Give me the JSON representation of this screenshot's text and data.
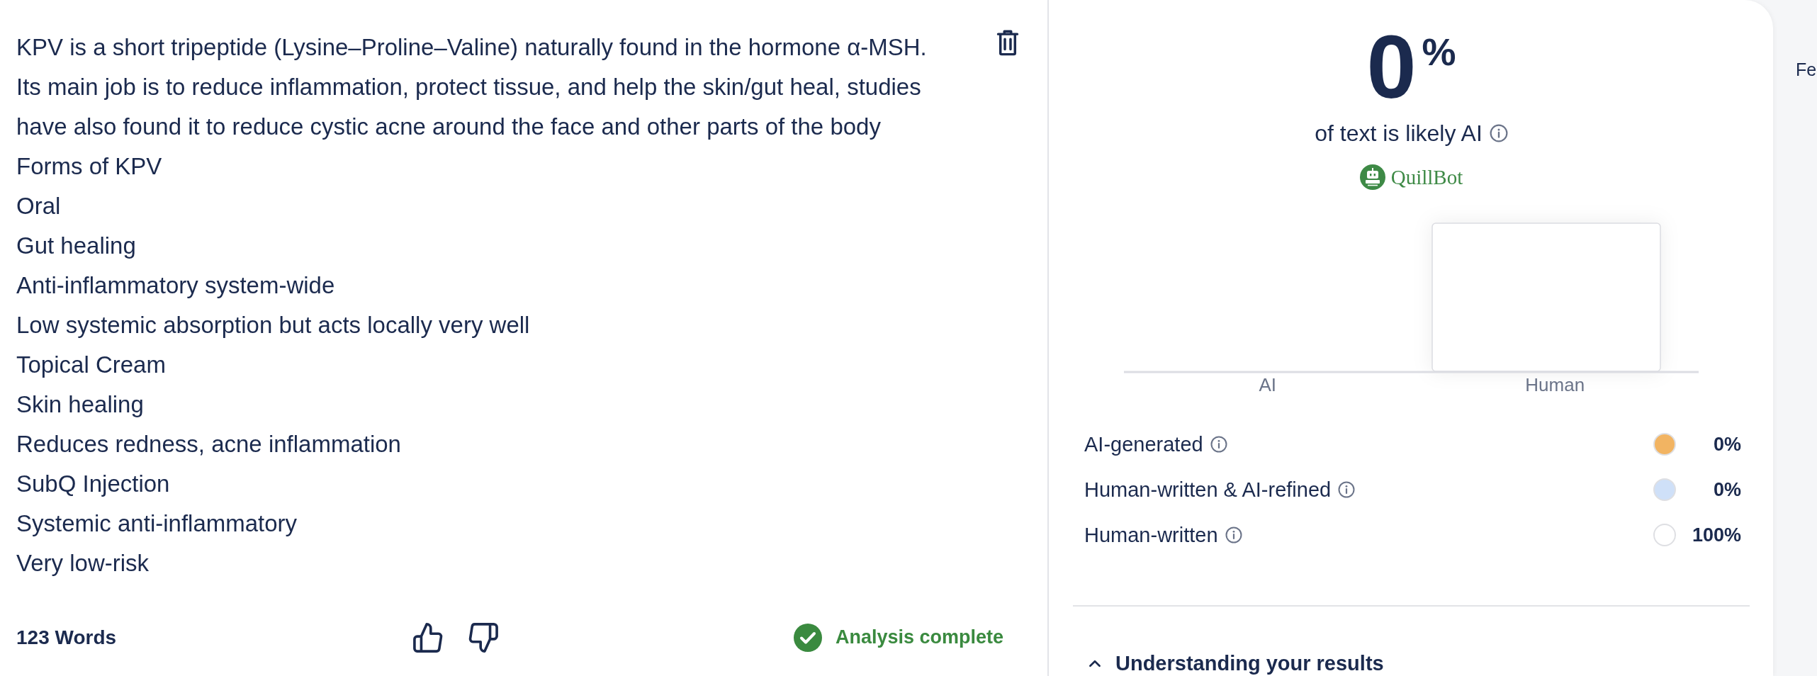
{
  "editor": {
    "paragraphs": [
      "KPV is a short tripeptide (Lysine–Proline–Valine) naturally found in the hormone α-MSH.",
      "Its main job is to reduce inflammation, protect tissue, and help the skin/gut heal, studies have also found it to reduce cystic acne around the face and other parts of the body",
      "Forms of KPV",
      "Oral",
      "Gut healing",
      "Anti-inflammatory system-wide",
      "Low systemic absorption but acts locally very well",
      "Topical Cream",
      "Skin healing",
      "Reduces redness, acne inflammation",
      "SubQ Injection",
      "Systemic anti-inflammatory",
      "Very low-risk"
    ],
    "word_count": "123 Words",
    "status": "Analysis complete"
  },
  "results": {
    "score": "0",
    "score_unit": "%",
    "caption": "of text is likely AI",
    "brand": "QuillBot",
    "chart": {
      "categories": [
        "AI",
        "Human"
      ]
    },
    "legend": [
      {
        "label": "AI-generated",
        "color": "#f2b462",
        "value": "0%"
      },
      {
        "label": "Human-written & AI-refined",
        "color": "#cfe0f8",
        "value": "0%"
      },
      {
        "label": "Human-written",
        "color": "#ffffff",
        "value": "100%"
      }
    ],
    "section": {
      "title": "Understanding your results",
      "expanded": true
    }
  },
  "side_panel": {
    "text": "Fe"
  }
}
